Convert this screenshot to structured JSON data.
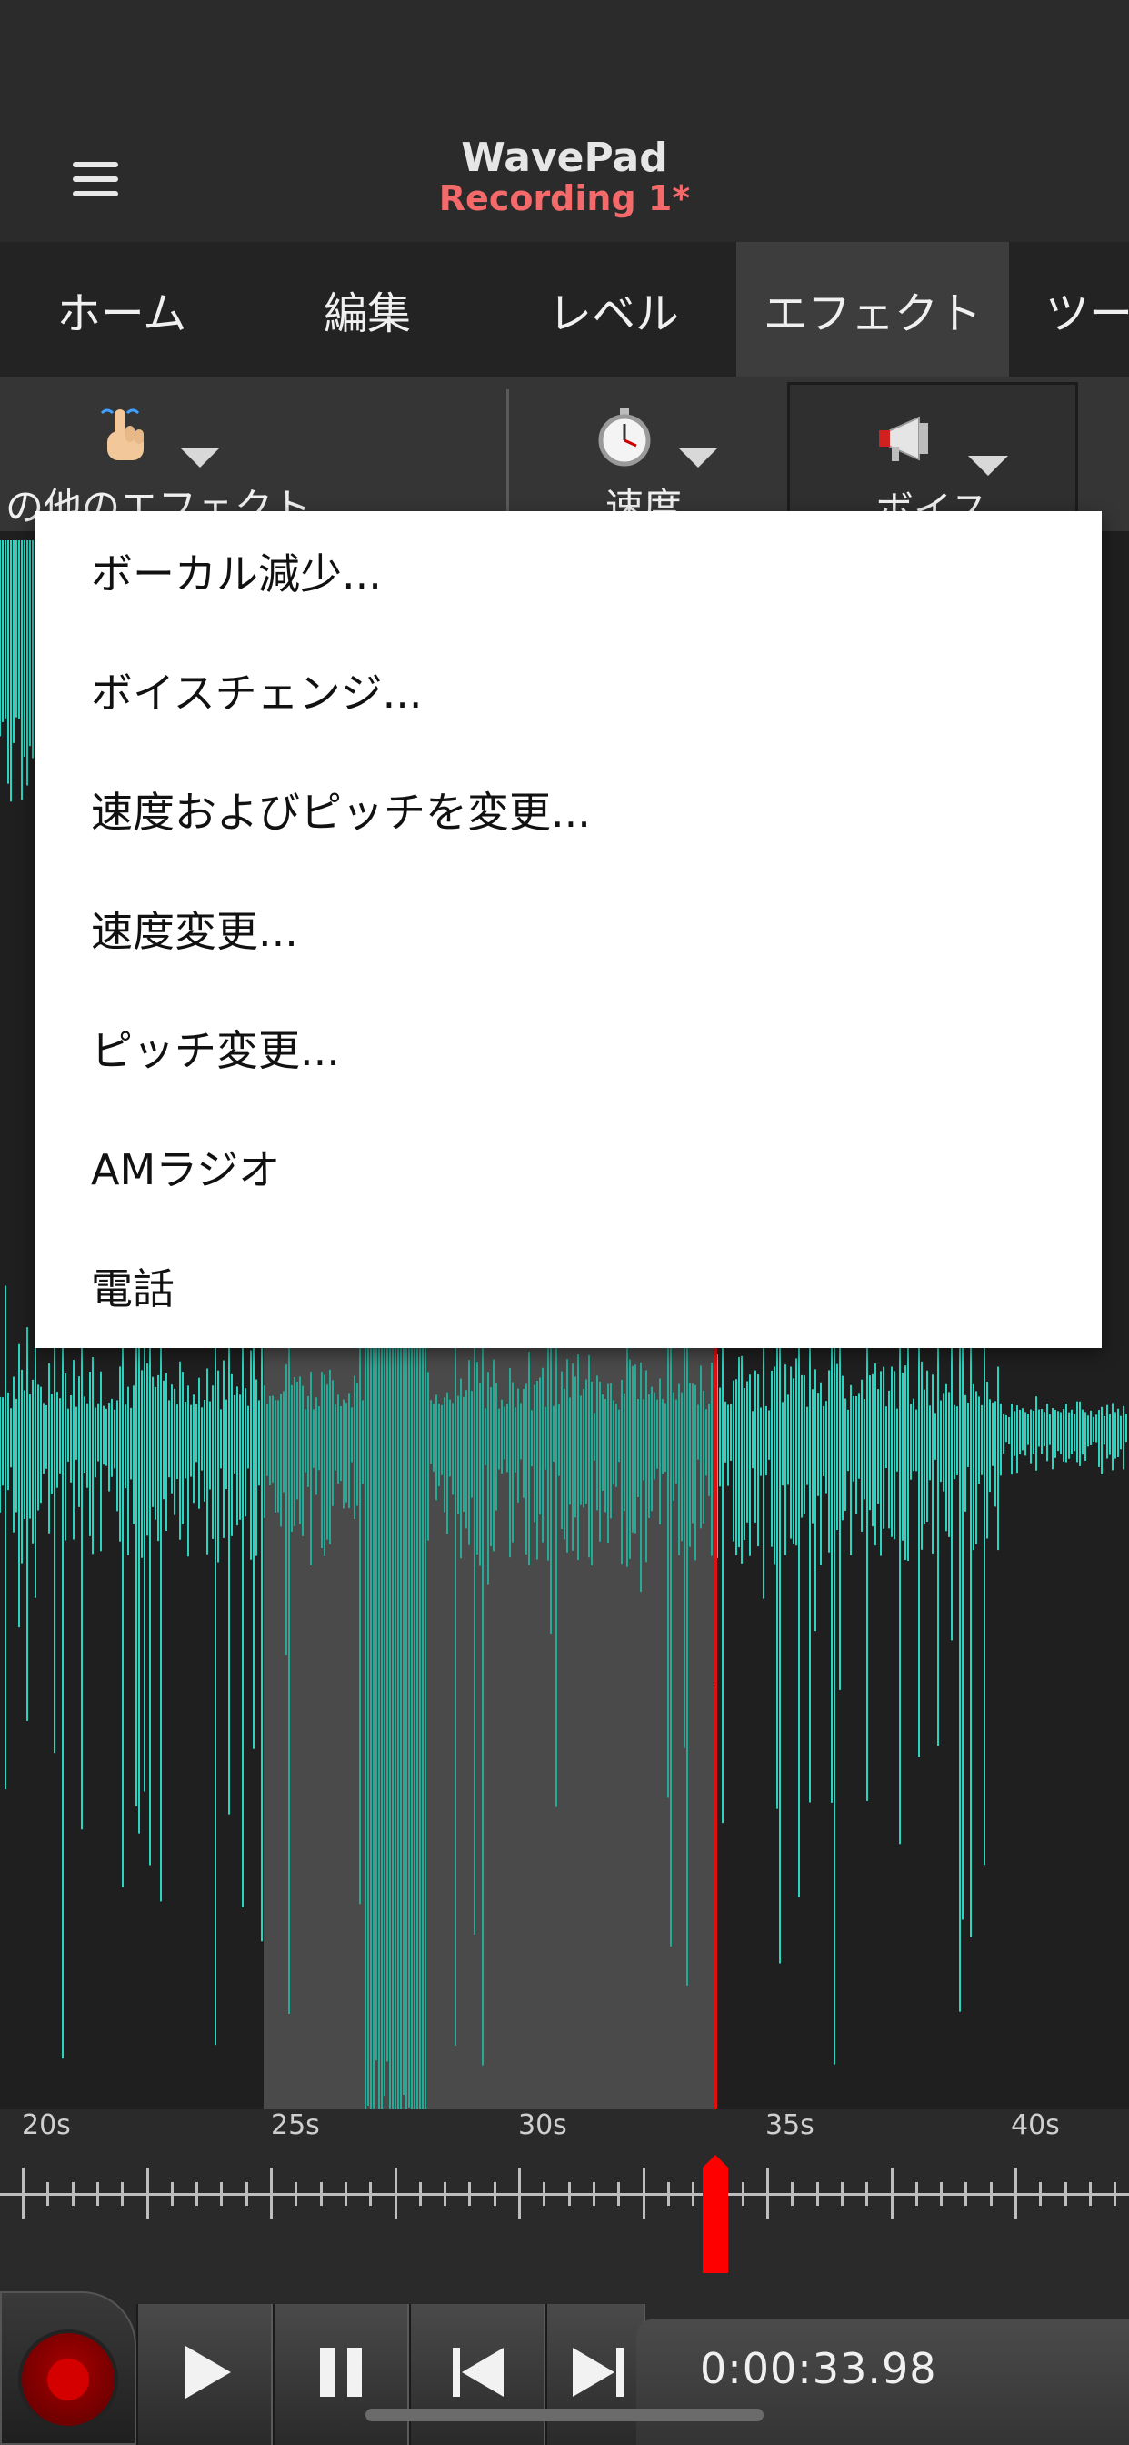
{
  "header": {
    "app_name": "WavePad",
    "file_name": "Recording 1*"
  },
  "tabs": [
    {
      "label": "ホーム"
    },
    {
      "label": "編集"
    },
    {
      "label": "レベル"
    },
    {
      "label": "エフェクト",
      "active": true
    },
    {
      "label": "ツー"
    }
  ],
  "toolbar": {
    "items": [
      {
        "label": "の他のエフェクト",
        "icon": "hand-pointer-icon"
      },
      {
        "label": "速度",
        "icon": "stopwatch-icon"
      },
      {
        "label": "ボイス",
        "icon": "megaphone-icon"
      }
    ]
  },
  "dropdown": {
    "items": [
      "ボーカル減少...",
      "ボイスチェンジ...",
      "速度およびピッチを変更...",
      "速度変更...",
      "ピッチ変更...",
      "AMラジオ",
      "電話"
    ]
  },
  "timeline": {
    "labels": [
      "20s",
      "25s",
      "30s",
      "35s",
      "40s"
    ]
  },
  "transport": {
    "time": "0:00:33.98",
    "buttons": [
      "record-icon",
      "play-icon",
      "pause-icon",
      "skip-back-icon",
      "skip-forward-icon"
    ]
  },
  "colors": {
    "waveform": "#2ad4c0",
    "waveform_selected": "#27a995",
    "playhead": "#ff0000",
    "file_name": "#f46a6a",
    "active_tab": "#3d3d3d"
  }
}
